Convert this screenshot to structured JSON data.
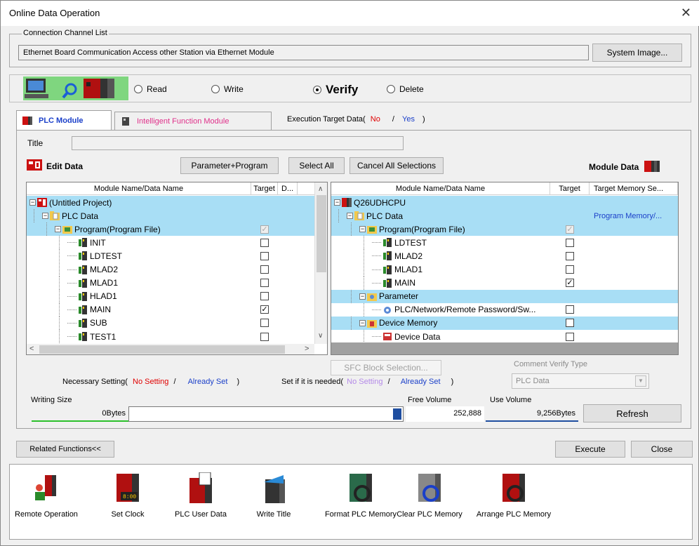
{
  "window": {
    "title": "Online Data Operation"
  },
  "connection": {
    "group_label": "Connection Channel List",
    "text": "Ethernet Board Communication  Access other Station via Ethernet Module",
    "system_image_btn": "System Image..."
  },
  "modes": {
    "read": "Read",
    "write": "Write",
    "verify": "Verify",
    "delete": "Delete",
    "selected": "Verify"
  },
  "tabs": {
    "plc_module": "PLC Module",
    "intelligent": "Intelligent Function Module"
  },
  "exec_target": {
    "label": "Execution Target Data(",
    "no": "No",
    "slash": "/",
    "yes": "Yes",
    "close": ")"
  },
  "title_field": {
    "label": "Title",
    "value": ""
  },
  "edit_data": {
    "label": "Edit Data"
  },
  "buttons": {
    "param_prog": "Parameter+Program",
    "select_all": "Select All",
    "cancel_all": "Cancel All Selections",
    "sfc_block": "SFC Block Selection...",
    "refresh": "Refresh",
    "related": "Related Functions<<",
    "execute": "Execute",
    "close": "Close"
  },
  "module_data": {
    "label": "Module Data"
  },
  "left_tree": {
    "headers": [
      "Module Name/Data Name",
      "Target",
      "D..."
    ],
    "rows": [
      {
        "name": "(Untitled Project)",
        "level": 0,
        "icon": "project",
        "toggle": "-",
        "hl": true,
        "check": ""
      },
      {
        "name": "PLC Data",
        "level": 1,
        "icon": "folder",
        "toggle": "-",
        "hl": true,
        "check": ""
      },
      {
        "name": "Program(Program File)",
        "level": 2,
        "icon": "program-folder",
        "toggle": "-",
        "hl": true,
        "check": "gray"
      },
      {
        "name": "INIT",
        "level": 3,
        "icon": "program",
        "toggle": "",
        "hl": false,
        "check": "off"
      },
      {
        "name": "LDTEST",
        "level": 3,
        "icon": "program",
        "toggle": "",
        "hl": false,
        "check": "off"
      },
      {
        "name": "MLAD2",
        "level": 3,
        "icon": "program",
        "toggle": "",
        "hl": false,
        "check": "off"
      },
      {
        "name": "MLAD1",
        "level": 3,
        "icon": "program",
        "toggle": "",
        "hl": false,
        "check": "off"
      },
      {
        "name": "HLAD1",
        "level": 3,
        "icon": "program",
        "toggle": "",
        "hl": false,
        "check": "off"
      },
      {
        "name": "MAIN",
        "level": 3,
        "icon": "program",
        "toggle": "",
        "hl": false,
        "check": "on"
      },
      {
        "name": "SUB",
        "level": 3,
        "icon": "program",
        "toggle": "",
        "hl": false,
        "check": "off"
      },
      {
        "name": "TEST1",
        "level": 3,
        "icon": "program",
        "toggle": "",
        "hl": false,
        "check": "off"
      }
    ]
  },
  "right_tree": {
    "headers": [
      "Module Name/Data Name",
      "Target",
      "Target Memory Se..."
    ],
    "rows": [
      {
        "name": "Q26UDHCPU",
        "level": 0,
        "icon": "cpu",
        "toggle": "-",
        "hl": true,
        "check": "",
        "mem": ""
      },
      {
        "name": "PLC Data",
        "level": 1,
        "icon": "folder",
        "toggle": "-",
        "hl": true,
        "check": "",
        "mem": "Program Memory/..."
      },
      {
        "name": "Program(Program File)",
        "level": 2,
        "icon": "program-folder",
        "toggle": "-",
        "hl": true,
        "check": "gray",
        "mem": ""
      },
      {
        "name": "LDTEST",
        "level": 3,
        "icon": "program",
        "toggle": "",
        "hl": false,
        "check": "off",
        "mem": ""
      },
      {
        "name": "MLAD2",
        "level": 3,
        "icon": "program",
        "toggle": "",
        "hl": false,
        "check": "off",
        "mem": ""
      },
      {
        "name": "MLAD1",
        "level": 3,
        "icon": "program",
        "toggle": "",
        "hl": false,
        "check": "off",
        "mem": ""
      },
      {
        "name": "MAIN",
        "level": 3,
        "icon": "program",
        "toggle": "",
        "hl": false,
        "check": "on",
        "mem": ""
      },
      {
        "name": "Parameter",
        "level": 2,
        "icon": "parameter",
        "toggle": "-",
        "hl": true,
        "check": "",
        "mem": ""
      },
      {
        "name": "PLC/Network/Remote Password/Sw...",
        "level": 3,
        "icon": "param-item",
        "toggle": "",
        "hl": false,
        "check": "off",
        "mem": ""
      },
      {
        "name": "Device Memory",
        "level": 2,
        "icon": "device-folder",
        "toggle": "-",
        "hl": true,
        "check": "off",
        "mem": ""
      },
      {
        "name": "Device Data",
        "level": 3,
        "icon": "device",
        "toggle": "",
        "hl": false,
        "check": "off",
        "mem": ""
      }
    ]
  },
  "necessary": {
    "label": "Necessary Setting(",
    "no": "No Setting",
    "slash": "/",
    "already": "Already Set",
    "close": ")"
  },
  "ifneeded": {
    "label": "Set if it is needed(",
    "no": "No Setting",
    "slash": "/",
    "already": "Already Set",
    "close": ")"
  },
  "comment_verify": {
    "label": "Comment Verify Type",
    "value": "PLC Data"
  },
  "writing_size": {
    "label": "Writing Size",
    "value": "0Bytes"
  },
  "free_volume": {
    "label": "Free Volume",
    "value": "252,888"
  },
  "use_volume": {
    "label": "Use Volume",
    "value": "9,256Bytes"
  },
  "functions": [
    {
      "label": "Remote Operation",
      "icon": "remote-operation-icon"
    },
    {
      "label": "Set Clock",
      "icon": "set-clock-icon"
    },
    {
      "label": "PLC User Data",
      "icon": "plc-user-data-icon"
    },
    {
      "label": "Write Title",
      "icon": "write-title-icon"
    },
    {
      "label": "Format PLC Memory",
      "icon": "format-plc-memory-icon"
    },
    {
      "label": "Clear PLC Memory",
      "icon": "clear-plc-memory-icon"
    },
    {
      "label": "Arrange PLC Memory",
      "icon": "arrange-plc-memory-icon"
    }
  ],
  "colors": {
    "highlight": "#a8def5",
    "red": "#e00000",
    "blue": "#1a3fc9",
    "plc_red": "#cc1111"
  }
}
